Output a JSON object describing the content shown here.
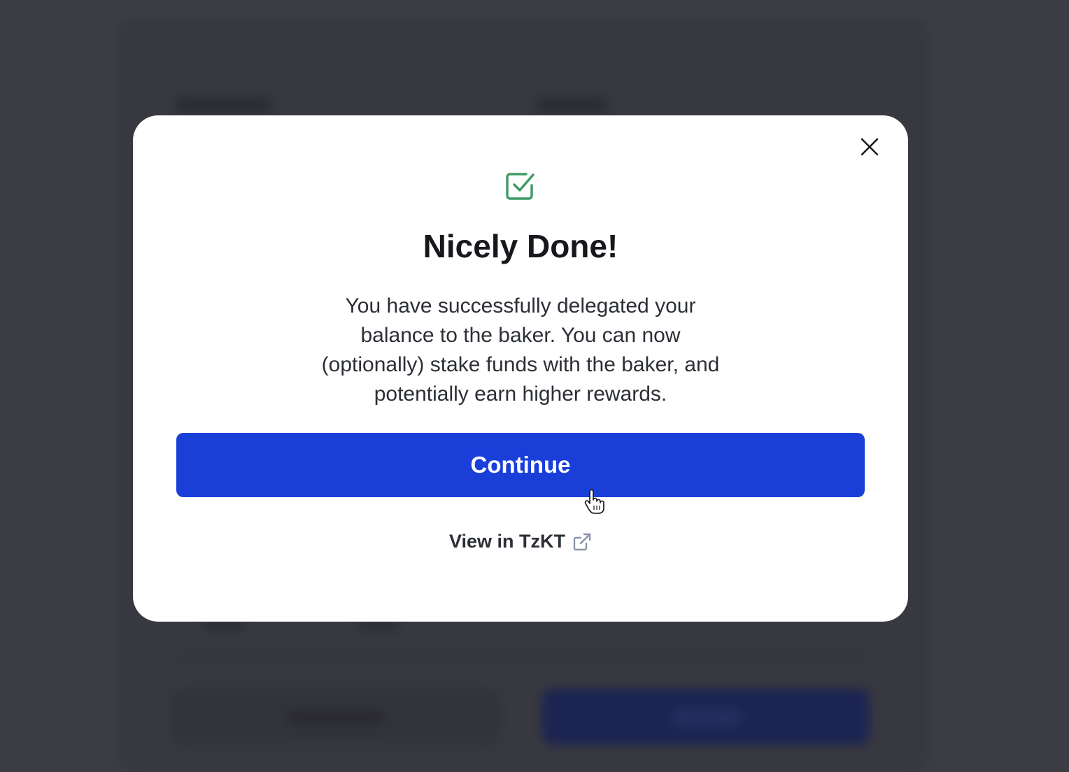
{
  "modal": {
    "title": "Nicely Done!",
    "message": "You have successfully delegated your balance to the baker. You can now (optionally) stake funds with the baker, and potentially earn higher rewards.",
    "primary_button_label": "Continue",
    "link_label": "View in TzKT",
    "icons": {
      "status": "checkbox-checked-icon",
      "close": "close-icon",
      "link": "external-link-icon"
    }
  },
  "colors": {
    "primary": "#1a3fd9",
    "success": "#3f9a63",
    "overlay": "#3c3c45",
    "text_dark": "#17171c"
  }
}
